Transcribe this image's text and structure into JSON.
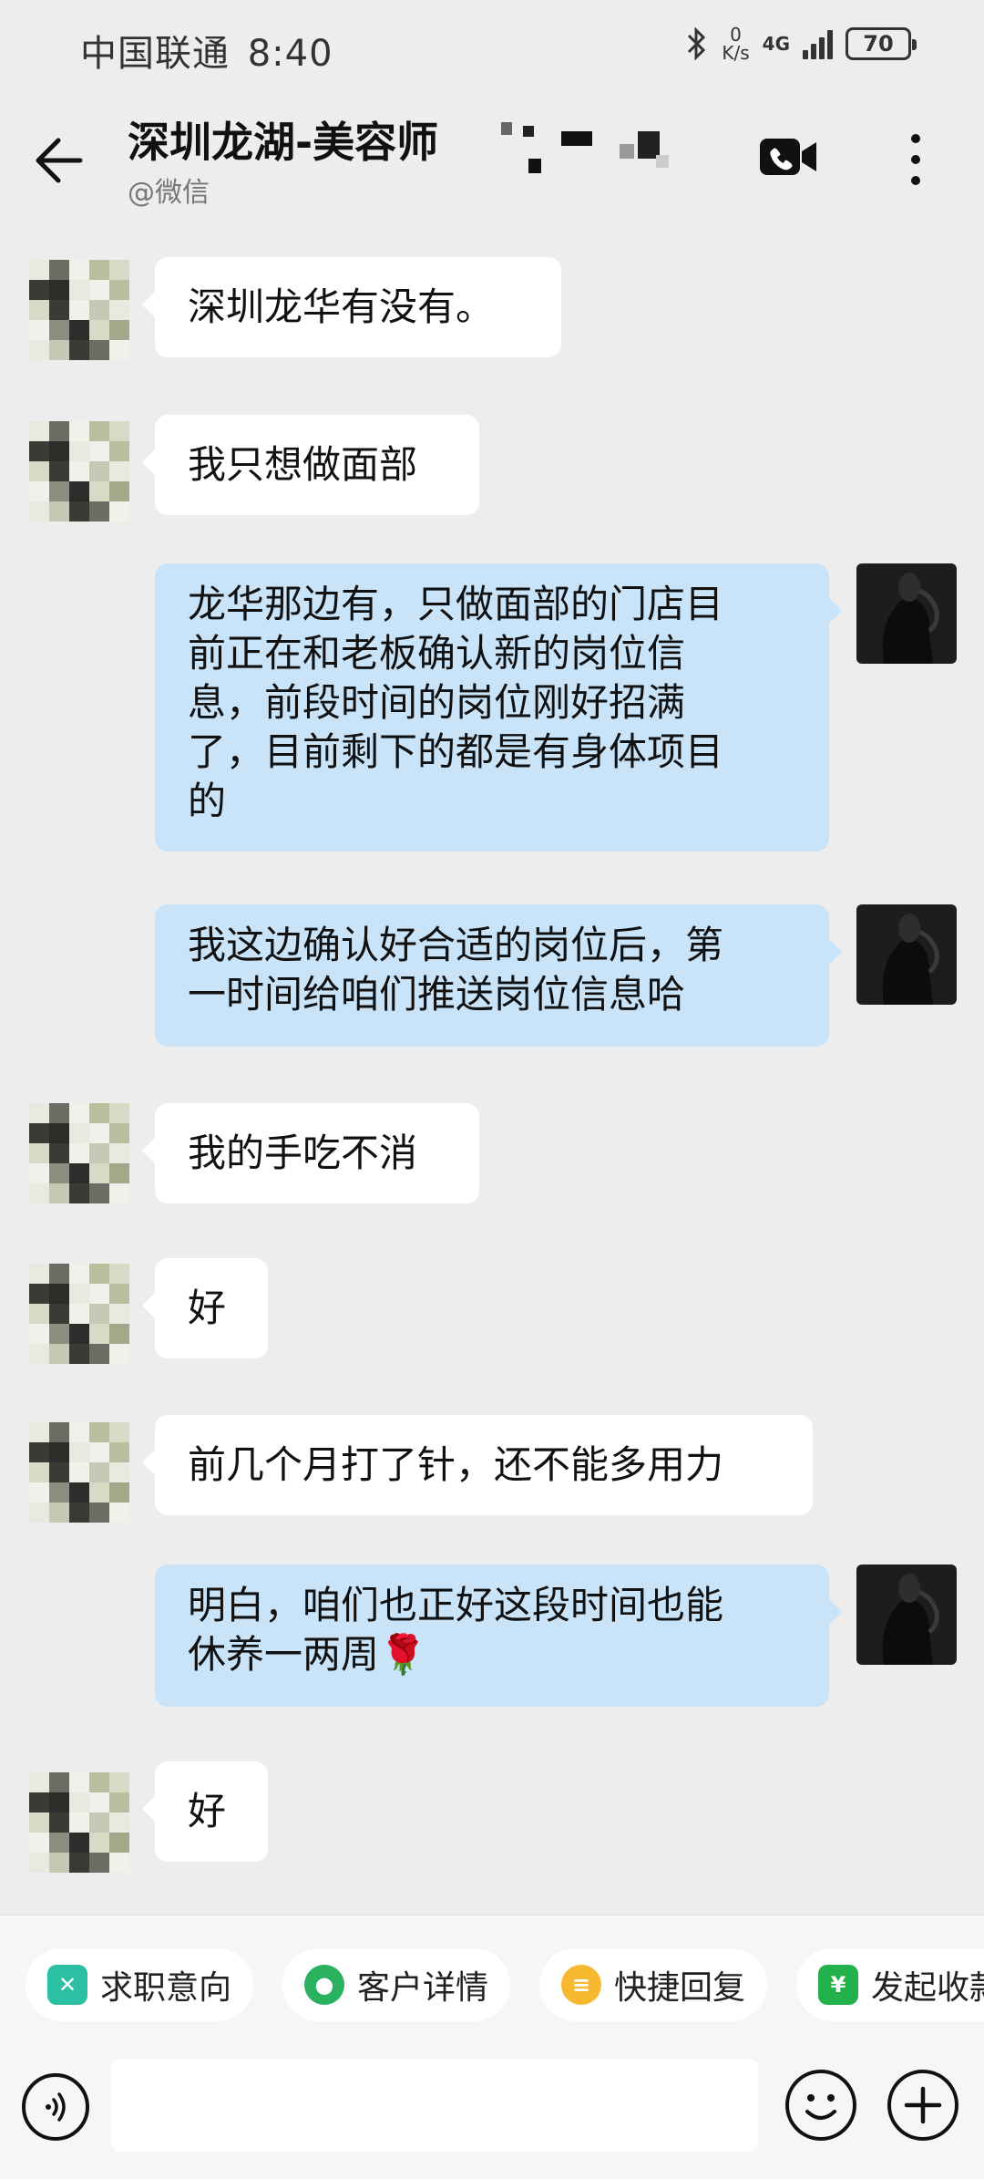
{
  "status_bar": {
    "carrier": "中国联通",
    "time": "8:40",
    "speed_value": "0",
    "speed_unit": "K/s",
    "network": "4G",
    "battery": "70"
  },
  "header": {
    "title": "深圳龙湖-美容师",
    "subtitle": "@微信"
  },
  "messages": [
    {
      "side": "in",
      "text": "深圳龙华有没有。"
    },
    {
      "side": "in",
      "text": "我只想做面部"
    },
    {
      "side": "out",
      "lines": [
        "龙华那边有，只做面部的门店目",
        "前正在和老板确认新的岗位信",
        "息，前段时间的岗位刚好招满",
        "了，目前剩下的都是有身体项目",
        "的"
      ]
    },
    {
      "side": "out",
      "lines": [
        "我这边确认好合适的岗位后，第",
        "一时间给咱们推送岗位信息哈"
      ]
    },
    {
      "side": "in",
      "text": "我的手吃不消"
    },
    {
      "side": "in",
      "text": "好"
    },
    {
      "side": "in",
      "text": "前几个月打了针，还不能多用力"
    },
    {
      "side": "out",
      "lines": [
        "明白，咱们也正好这段时间也能",
        "休养一两周"
      ],
      "emoji": "🌹"
    },
    {
      "side": "in",
      "text": "好"
    }
  ],
  "quick_actions": [
    {
      "label": "求职意向",
      "icon": "job-intent-icon",
      "color": "#2bbfa4"
    },
    {
      "label": "客户详情",
      "icon": "customer-detail-icon",
      "color": "#2ab260"
    },
    {
      "label": "快捷回复",
      "icon": "quick-reply-icon",
      "color": "#f5b82e"
    },
    {
      "label": "发起收款",
      "icon": "payment-icon",
      "color": "#22b14c"
    }
  ],
  "input": {
    "placeholder": ""
  },
  "colors": {
    "background": "#ededed",
    "incoming_bubble": "#ffffff",
    "outgoing_bubble": "#c9e3f8"
  }
}
